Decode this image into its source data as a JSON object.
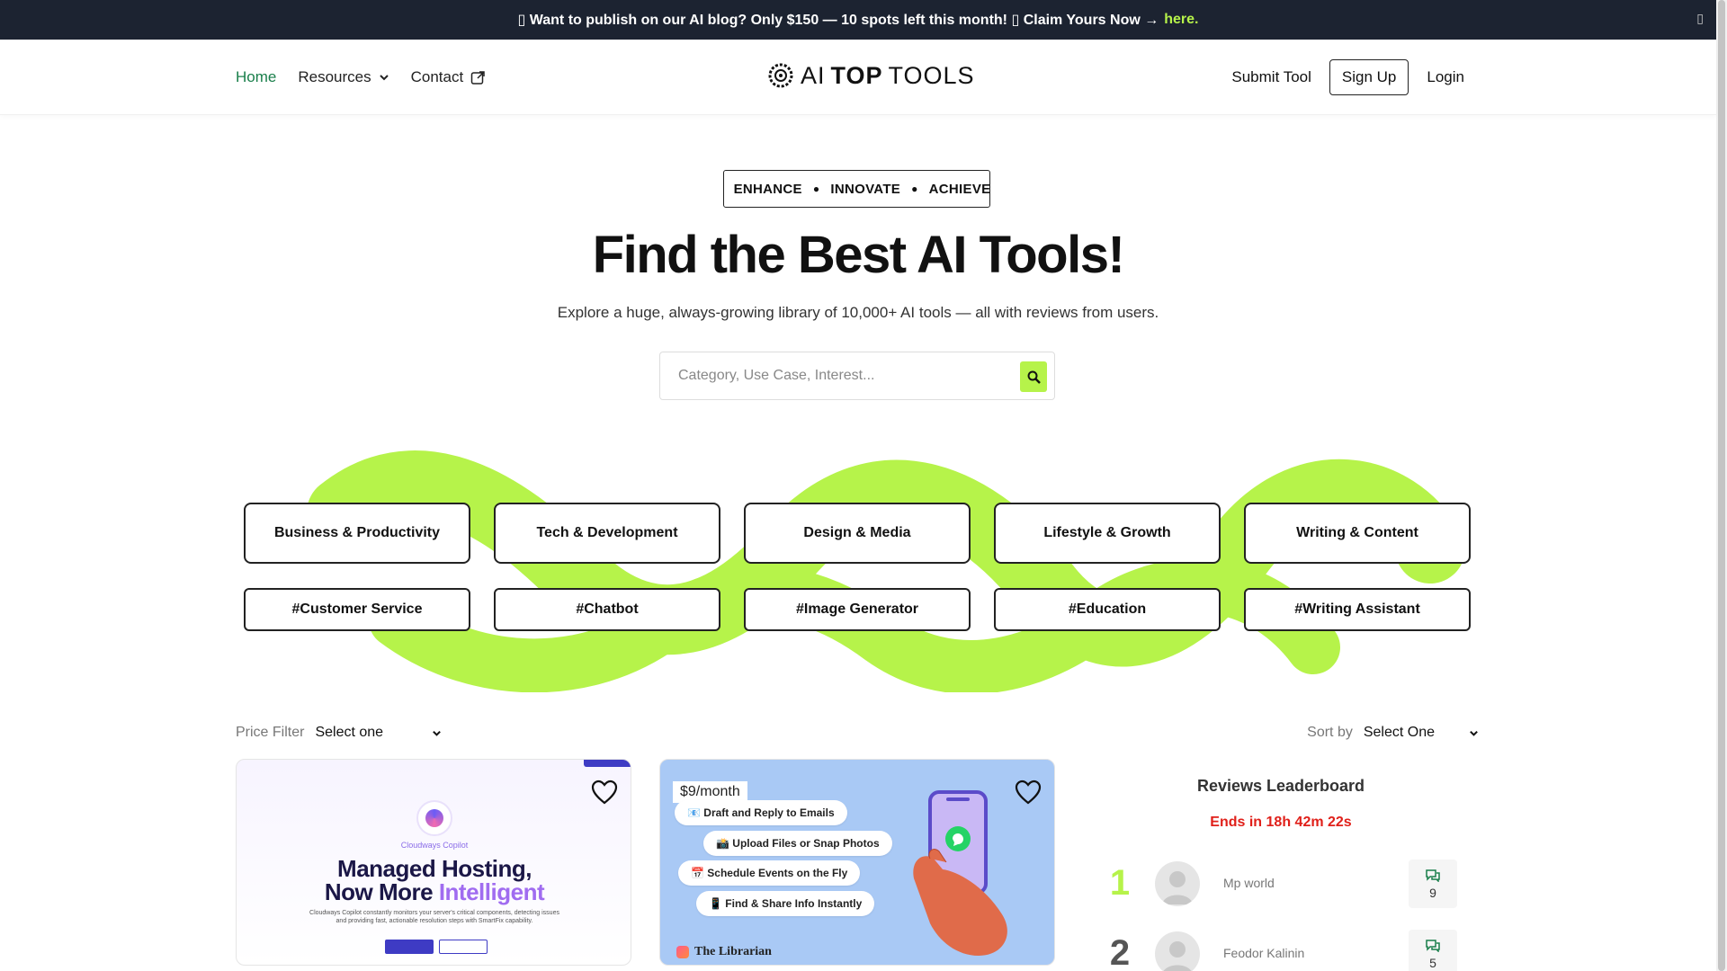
{
  "announcement": {
    "text": "▯ Want to publish on our AI blog? Only $150 — 10 spots left this month! ▯ Claim Yours Now →",
    "link": "here.",
    "close": "▯"
  },
  "nav": {
    "home": "Home",
    "resources": "Resources",
    "contact": "Contact",
    "logo_prefix": "AI",
    "logo_bold": "TOP",
    "logo_suffix": "TOOLS",
    "submit": "Submit Tool",
    "signup": "Sign Up",
    "login": "Login"
  },
  "hero": {
    "pill": [
      "ENHANCE",
      "INNOVATE",
      "ACHIEVE"
    ],
    "title": "Find the Best AI Tools!",
    "subtitle": "Explore a huge, always-growing library of 10,000+ AI tools — all with reviews from users.",
    "search_placeholder": "Category, Use Case, Interest..."
  },
  "categories": [
    "Business & Productivity",
    "Tech & Development",
    "Design & Media",
    "Lifestyle & Growth",
    "Writing & Content"
  ],
  "tags": [
    "#Customer Service",
    "#Chatbot",
    "#Image Generator",
    "#Education",
    "#Writing Assistant"
  ],
  "filters": {
    "price_label": "Price Filter",
    "price_value": "Select one",
    "sort_label": "Sort by",
    "sort_value": "Select One"
  },
  "card1": {
    "brand": "Cloudways Copilot",
    "headline_1": "Managed Hosting,",
    "headline_2a": "Now More ",
    "headline_2b": "Intelligent",
    "body": "Cloudways Copilot constantly monitors your server's critical components, detecting issues and providing fast, actionable resolution steps with SmartFix capability."
  },
  "card2": {
    "price": "$9/month",
    "chips": [
      "📧 Draft and Reply to Emails",
      "📸 Upload Files or Snap Photos",
      "📅 Schedule Events on the Fly",
      "📱 Find & Share Info Instantly"
    ],
    "brand": "The Librarian"
  },
  "leaderboard": {
    "title": "Reviews Leaderboard",
    "timer": "Ends in 18h 42m 22s",
    "rows": [
      {
        "rank": "1",
        "name": "Mp world",
        "count": "9",
        "color": "#b6f34a"
      },
      {
        "rank": "2",
        "name": "Feodor Kalinin",
        "count": "5",
        "color": "#555555"
      }
    ]
  },
  "colors": {
    "accent": "#b6f34a",
    "dark": "#1c2331",
    "home": "#1a7f4b",
    "timer": "#e0201a"
  }
}
